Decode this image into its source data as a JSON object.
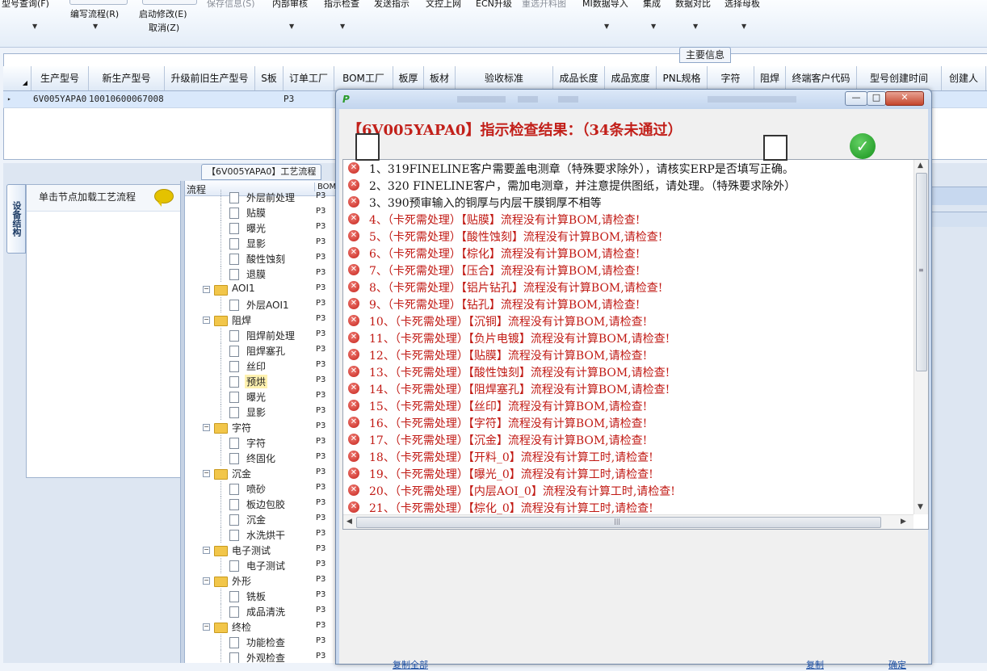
{
  "toolbar": {
    "items": [
      {
        "label": "型号查询(F)",
        "dim": false
      },
      {
        "label": "编写流程(R)",
        "dim": false
      },
      {
        "label": "启动修改(E)",
        "dim": false
      },
      {
        "label": "取消(Z)",
        "dim": false
      },
      {
        "label": "保存信息(S)",
        "dim": true
      },
      {
        "label": "内部审核",
        "dim": false
      },
      {
        "label": "指示检查",
        "dim": false
      },
      {
        "label": "发送指示",
        "dim": false
      },
      {
        "label": "文控上网",
        "dim": false
      },
      {
        "label": "ECN升级",
        "dim": false
      },
      {
        "label": "重选开料图",
        "dim": true
      },
      {
        "label": "MI数据导入",
        "dim": false
      },
      {
        "label": "集成",
        "dim": false
      },
      {
        "label": "数据对比",
        "dim": false
      },
      {
        "label": "选择母板",
        "dim": false
      }
    ]
  },
  "grid": {
    "tab_label": "主要信息",
    "columns": [
      "生产型号",
      "新生产型号",
      "升级前旧生产型号",
      "S板",
      "订单工厂",
      "BOM工厂",
      "板厚",
      "板材",
      "验收标准",
      "成品长度",
      "成品宽度",
      "PNL规格",
      "字符",
      "阻焊",
      "终端客户代码",
      "型号创建时间",
      "创建人"
    ],
    "rows": [
      {
        "marker": "▸",
        "model": "6V005YAPA0",
        "new_model": "10010600067008",
        "factory": "P3"
      }
    ]
  },
  "side_tab": "设备结构",
  "left_panel": {
    "hint": "单击节点加载工艺流程"
  },
  "flow_tab": "【6V005YAPA0】工艺流程",
  "tree": {
    "header_flow": "流程",
    "header_bom": "BOM",
    "rows": [
      {
        "label": "外层前处理",
        "level": 2,
        "code": "P3"
      },
      {
        "label": "贴膜",
        "level": 2,
        "code": "P3"
      },
      {
        "label": "曝光",
        "level": 2,
        "code": "P3"
      },
      {
        "label": "显影",
        "level": 2,
        "code": "P3"
      },
      {
        "label": "酸性蚀刻",
        "level": 2,
        "code": "P3"
      },
      {
        "label": "退膜",
        "level": 2,
        "code": "P3"
      },
      {
        "label": "AOI1",
        "level": 1,
        "code": "P3"
      },
      {
        "label": "外层AOI1",
        "level": 2,
        "code": "P3"
      },
      {
        "label": "阻焊",
        "level": 1,
        "code": "P3"
      },
      {
        "label": "阻焊前处理",
        "level": 2,
        "code": "P3"
      },
      {
        "label": "阻焊塞孔",
        "level": 2,
        "code": "P3"
      },
      {
        "label": "丝印",
        "level": 2,
        "code": "P3"
      },
      {
        "label": "预烘",
        "level": 2,
        "code": "P3",
        "selected": true
      },
      {
        "label": "曝光",
        "level": 2,
        "code": "P3"
      },
      {
        "label": "显影",
        "level": 2,
        "code": "P3"
      },
      {
        "label": "字符",
        "level": 1,
        "code": "P3"
      },
      {
        "label": "字符",
        "level": 2,
        "code": "P3"
      },
      {
        "label": "终固化",
        "level": 2,
        "code": "P3"
      },
      {
        "label": "沉金",
        "level": 1,
        "code": "P3"
      },
      {
        "label": "喷砂",
        "level": 2,
        "code": "P3"
      },
      {
        "label": "板边包胶",
        "level": 2,
        "code": "P3"
      },
      {
        "label": "沉金",
        "level": 2,
        "code": "P3"
      },
      {
        "label": "水洗烘干",
        "level": 2,
        "code": "P3"
      },
      {
        "label": "电子测试",
        "level": 1,
        "code": "P3"
      },
      {
        "label": "电子测试",
        "level": 2,
        "code": "P3"
      },
      {
        "label": "外形",
        "level": 1,
        "code": "P3"
      },
      {
        "label": "铣板",
        "level": 2,
        "code": "P3"
      },
      {
        "label": "成品清洗",
        "level": 2,
        "code": "P3"
      },
      {
        "label": "终检",
        "level": 1,
        "code": "P3"
      },
      {
        "label": "功能检查",
        "level": 2,
        "code": "P3"
      },
      {
        "label": "外观检查",
        "level": 2,
        "code": "P3"
      }
    ]
  },
  "dialog": {
    "app_icon": "P",
    "window_buttons": {
      "minimize": "—",
      "maximize": "□",
      "close": "✕"
    },
    "result_title": "【6V005YAPA0】指示检查结果：（34条未通过）",
    "items": [
      {
        "text": "1、319FINELINE客户需要盖电测章（特殊要求除外），请核实ERP是否填写正确。",
        "color": "black"
      },
      {
        "text": "2、320 FINELINE客户，需加电测章，并注意提供图纸，请处理。（特殊要求除外）",
        "color": "black"
      },
      {
        "text": "3、390预审输入的铜厚与内层干膜铜厚不相等",
        "color": "black"
      },
      {
        "text": "4、（卡死需处理）【贴膜】流程没有计算BOM,请检查!",
        "color": "red"
      },
      {
        "text": "5、（卡死需处理）【酸性蚀刻】流程没有计算BOM,请检查!",
        "color": "red"
      },
      {
        "text": "6、（卡死需处理）【棕化】流程没有计算BOM,请检查!",
        "color": "red"
      },
      {
        "text": "7、（卡死需处理）【压合】流程没有计算BOM,请检查!",
        "color": "red"
      },
      {
        "text": "8、（卡死需处理）【铝片钻孔】流程没有计算BOM,请检查!",
        "color": "red"
      },
      {
        "text": "9、（卡死需处理）【钻孔】流程没有计算BOM,请检查!",
        "color": "red"
      },
      {
        "text": "10、（卡死需处理）【沉铜】流程没有计算BOM,请检查!",
        "color": "red"
      },
      {
        "text": "11、（卡死需处理）【负片电镀】流程没有计算BOM,请检查!",
        "color": "red"
      },
      {
        "text": "12、（卡死需处理）【贴膜】流程没有计算BOM,请检查!",
        "color": "red"
      },
      {
        "text": "13、（卡死需处理）【酸性蚀刻】流程没有计算BOM,请检查!",
        "color": "red"
      },
      {
        "text": "14、（卡死需处理）【阻焊塞孔】流程没有计算BOM,请检查!",
        "color": "red"
      },
      {
        "text": "15、（卡死需处理）【丝印】流程没有计算BOM,请检查!",
        "color": "red"
      },
      {
        "text": "16、（卡死需处理）【字符】流程没有计算BOM,请检查!",
        "color": "red"
      },
      {
        "text": "17、（卡死需处理）【沉金】流程没有计算BOM,请检查!",
        "color": "red"
      },
      {
        "text": "18、（卡死需处理）【开料_0】流程没有计算工时,请检查!",
        "color": "red"
      },
      {
        "text": "19、（卡死需处理）【曝光_0】流程没有计算工时,请检查!",
        "color": "red"
      },
      {
        "text": "20、（卡死需处理）【内层AOI_0】流程没有计算工时,请检查!",
        "color": "red"
      },
      {
        "text": "21、（卡死需处理）【棕化_0】流程没有计算工时,请检查!",
        "color": "red"
      }
    ],
    "footer": {
      "copy_all": "复制全部",
      "copy": "复制",
      "ok": "确定"
    }
  },
  "colors": {
    "error_red": "#c11a14",
    "title_red": "#c2201a",
    "selection": "#d9e8fb"
  }
}
